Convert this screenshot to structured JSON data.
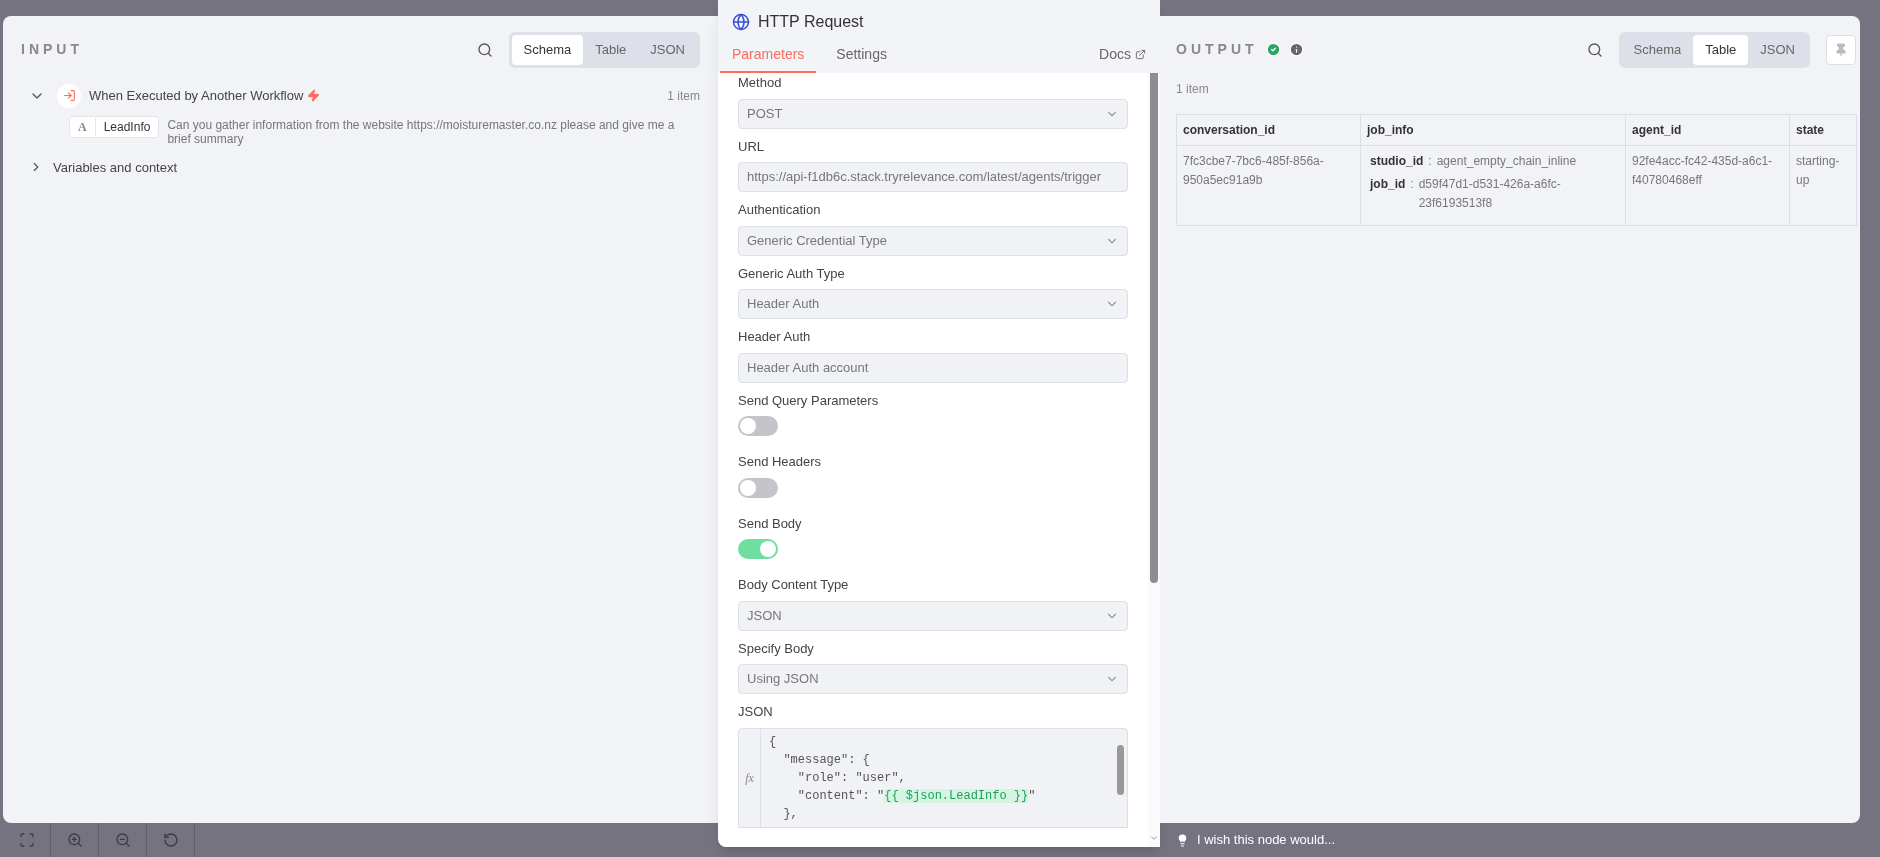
{
  "input": {
    "title": "INPUT",
    "views": [
      {
        "label": "Schema",
        "selected": true
      },
      {
        "label": "Table",
        "selected": false
      },
      {
        "label": "JSON",
        "selected": false
      }
    ],
    "trigger": {
      "title": "When Executed by Another Workflow",
      "expanded": true,
      "count": "1 item",
      "fields": [
        {
          "type": "A",
          "name": "LeadInfo",
          "value": "Can you gather information from the website https://moisturemaster.co.nz please and give me a brief summary"
        }
      ]
    },
    "context": {
      "label": "Variables and context",
      "expanded": false
    }
  },
  "node": {
    "title": "HTTP Request",
    "tabs": [
      {
        "label": "Parameters",
        "selected": true
      },
      {
        "label": "Settings",
        "selected": false
      }
    ],
    "docs": "Docs",
    "parameters": [
      {
        "kind": "select",
        "label": "Method",
        "value": "POST"
      },
      {
        "kind": "text",
        "label": "URL",
        "value": "https://api-f1db6c.stack.tryrelevance.com/latest/agents/trigger"
      },
      {
        "kind": "select",
        "label": "Authentication",
        "value": "Generic Credential Type"
      },
      {
        "kind": "select",
        "label": "Generic Auth Type",
        "value": "Header Auth"
      },
      {
        "kind": "text",
        "label": "Header Auth",
        "value": "Header Auth account"
      },
      {
        "kind": "toggle",
        "label": "Send Query Parameters",
        "on": false
      },
      {
        "kind": "toggle",
        "label": "Send Headers",
        "on": false
      },
      {
        "kind": "toggle",
        "label": "Send Body",
        "on": true
      },
      {
        "kind": "select",
        "label": "Body Content Type",
        "value": "JSON"
      },
      {
        "kind": "select",
        "label": "Specify Body",
        "value": "Using JSON"
      },
      {
        "kind": "code",
        "label": "JSON",
        "prefix": "fx",
        "lines": [
          [
            {
              "kind": "text",
              "text": "{"
            }
          ],
          [
            {
              "kind": "text",
              "text": "  \"message\": {"
            }
          ],
          [
            {
              "kind": "text",
              "text": "    \"role\": \"user\","
            }
          ],
          [
            {
              "kind": "text",
              "text": "    \"content\": \""
            },
            {
              "kind": "expr",
              "text": "{{ $json.LeadInfo }}"
            },
            {
              "kind": "text",
              "text": "\""
            }
          ],
          [
            {
              "kind": "text",
              "text": "  },"
            }
          ]
        ]
      }
    ]
  },
  "output": {
    "title": "OUTPUT",
    "views": [
      {
        "label": "Schema",
        "selected": false
      },
      {
        "label": "Table",
        "selected": true
      },
      {
        "label": "JSON",
        "selected": false
      }
    ],
    "count": "1 item",
    "table": {
      "columns": [
        "conversation_id",
        "job_info",
        "agent_id",
        "state"
      ],
      "rows": [
        {
          "cells": [
            {
              "kind": "text",
              "text": "7fc3cbe7-7bc6-485f-856a-950a5ec91a9b"
            },
            {
              "kind": "fields",
              "fields": [
                {
                  "key": "studio_id",
                  "separator": ":",
                  "value": "agent_empty_chain_inline"
                },
                {
                  "key": "job_id",
                  "separator": ":",
                  "value": "d59f47d1-d531-426a-a6fc-23f6193513f8"
                }
              ]
            },
            {
              "kind": "text",
              "text": "92fe4acc-fc42-435d-a6c1-f40780468eff"
            },
            {
              "kind": "text",
              "text": "starting-up"
            }
          ]
        }
      ]
    }
  },
  "canvas_hint": "I wish this node would..."
}
